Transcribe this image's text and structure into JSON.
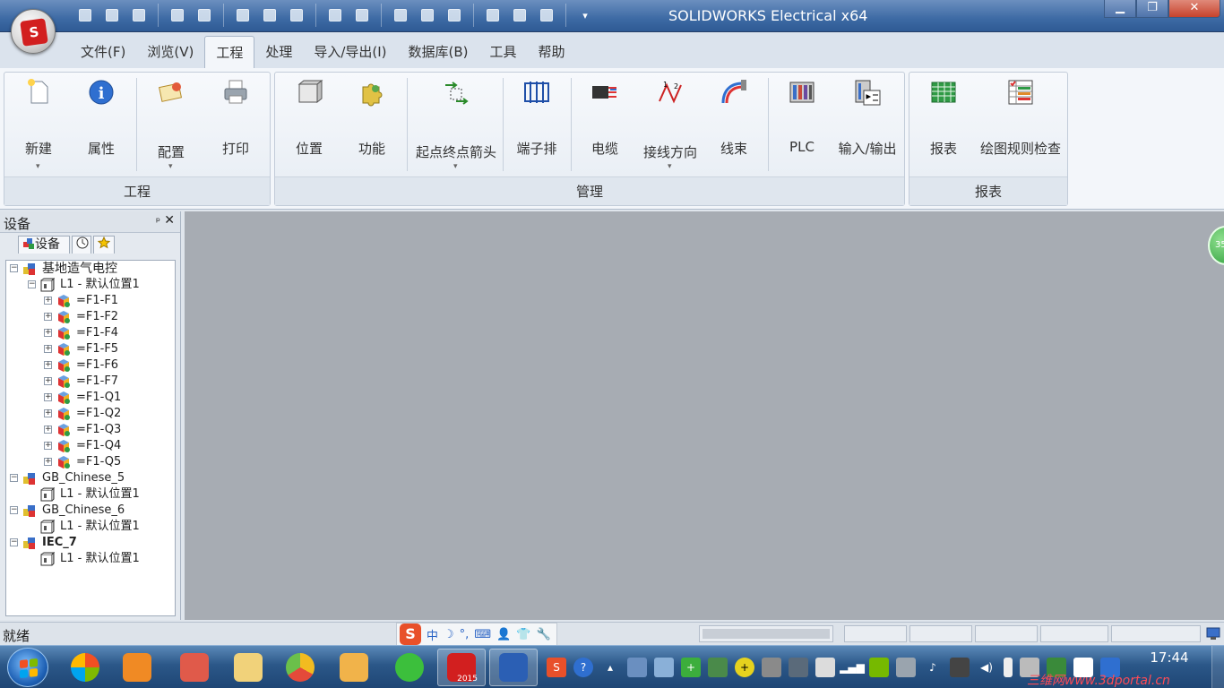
{
  "window": {
    "title": "SOLIDWORKS Electrical x64",
    "app_logo_text": "S"
  },
  "menu_tabs": [
    "文件(F)",
    "浏览(V)",
    "工程",
    "处理",
    "导入/导出(I)",
    "数据库(B)",
    "工具",
    "帮助"
  ],
  "active_tab": "工程",
  "ribbon": {
    "groups": [
      {
        "label": "工程",
        "buttons": [
          "新建",
          "属性",
          "配置",
          "打印"
        ]
      },
      {
        "label": "管理",
        "buttons": [
          "位置",
          "功能",
          "起点终点箭头",
          "端子排",
          "电缆",
          "接线方向",
          "线束",
          "PLC",
          "输入/输出"
        ]
      },
      {
        "label": "报表",
        "buttons": [
          "报表",
          "绘图规则检查"
        ]
      }
    ]
  },
  "panel": {
    "title": "设备",
    "pin_glyph": "ᵖ",
    "close_glyph": "✕",
    "tab_label": "设备",
    "tree": [
      {
        "label": "基地造气电控",
        "level": 0
      },
      {
        "label": "L1 - 默认位置1",
        "level": 1
      },
      {
        "label": "=F1-F1",
        "level": 2
      },
      {
        "label": "=F1-F2",
        "level": 2
      },
      {
        "label": "=F1-F4",
        "level": 2
      },
      {
        "label": "=F1-F5",
        "level": 2
      },
      {
        "label": "=F1-F6",
        "level": 2
      },
      {
        "label": "=F1-F7",
        "level": 2
      },
      {
        "label": "=F1-Q1",
        "level": 2
      },
      {
        "label": "=F1-Q2",
        "level": 2
      },
      {
        "label": "=F1-Q3",
        "level": 2
      },
      {
        "label": "=F1-Q4",
        "level": 2
      },
      {
        "label": "=F1-Q5",
        "level": 2
      },
      {
        "label": "GB_Chinese_5",
        "level": 0
      },
      {
        "label": "L1 - 默认位置1",
        "level": 1
      },
      {
        "label": "GB_Chinese_6",
        "level": 0
      },
      {
        "label": "L1 - 默认位置1",
        "level": 1
      },
      {
        "label": "IEC_7",
        "level": 0,
        "bold": true
      },
      {
        "label": "L1 - 默认位置1",
        "level": 1
      }
    ]
  },
  "edge_badge": "35",
  "status": {
    "text": "就绪",
    "ime": {
      "logo": "S",
      "mode": "中",
      "moon": "☽",
      "punct": "°,",
      "keyboard": "⌨",
      "user": "👤",
      "shirt": "👕",
      "wrench": "🔧"
    }
  },
  "taskbar": {
    "time": "17:44",
    "active_badge": "2015",
    "watermark": "三维网www.3dportal.cn"
  },
  "colors": {
    "title_bar": "#3d6aa4",
    "workspace": "#a7acb3",
    "accent_red": "#d21f1f",
    "taskbar": "#2b5788"
  }
}
